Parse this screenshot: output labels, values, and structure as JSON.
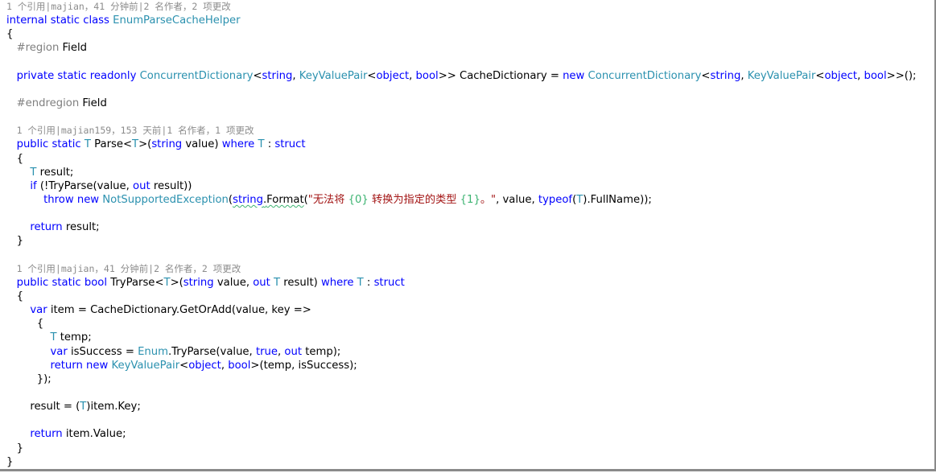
{
  "lenses": {
    "class": "1 个引用|majian，41 分钟前|2 名作者，2 项更改",
    "parse": "1 个引用|majian159，153 天前|1 名作者，1 项更改",
    "tryparse": "1 个引用|majian，41 分钟前|2 名作者，2 项更改"
  },
  "code": {
    "class_modifiers": "internal static class",
    "class_name": "EnumParseCacheHelper",
    "brace_open": "{",
    "brace_close": "}",
    "region_directive": "#region",
    "region_name": "Field",
    "endregion_directive": "#endregion",
    "field_modifiers": "private static readonly",
    "concurrent_dictionary": "ConcurrentDictionary",
    "key_value_pair": "KeyValuePair",
    "kw_string": "string",
    "kw_object": "object",
    "kw_bool": "bool",
    "kw_new": "new",
    "kw_public_static": "public static",
    "kw_where": "where",
    "kw_struct": "struct",
    "kw_if": "if",
    "kw_out": "out",
    "kw_throw_new": "throw new",
    "kw_return": "return",
    "kw_return_new": "return new",
    "kw_typeof": "typeof",
    "kw_var": "var",
    "kw_true": "true",
    "type_T": "T",
    "enum_type": "Enum",
    "exception_type": "NotSupportedException",
    "field_name": "CacheDictionary",
    "field_init_end": ">>();",
    "parse_name": "Parse",
    "tryparse_name": "TryParse",
    "error_message_part1": "\"无法将 ",
    "error_placeholder_0": "{0}",
    "error_message_part2": " 转换为指定的类型 ",
    "error_placeholder_1": "{1}",
    "error_message_part3": "。\"",
    "string_format_member": "Format",
    "full_name_member": ").FullName));"
  }
}
